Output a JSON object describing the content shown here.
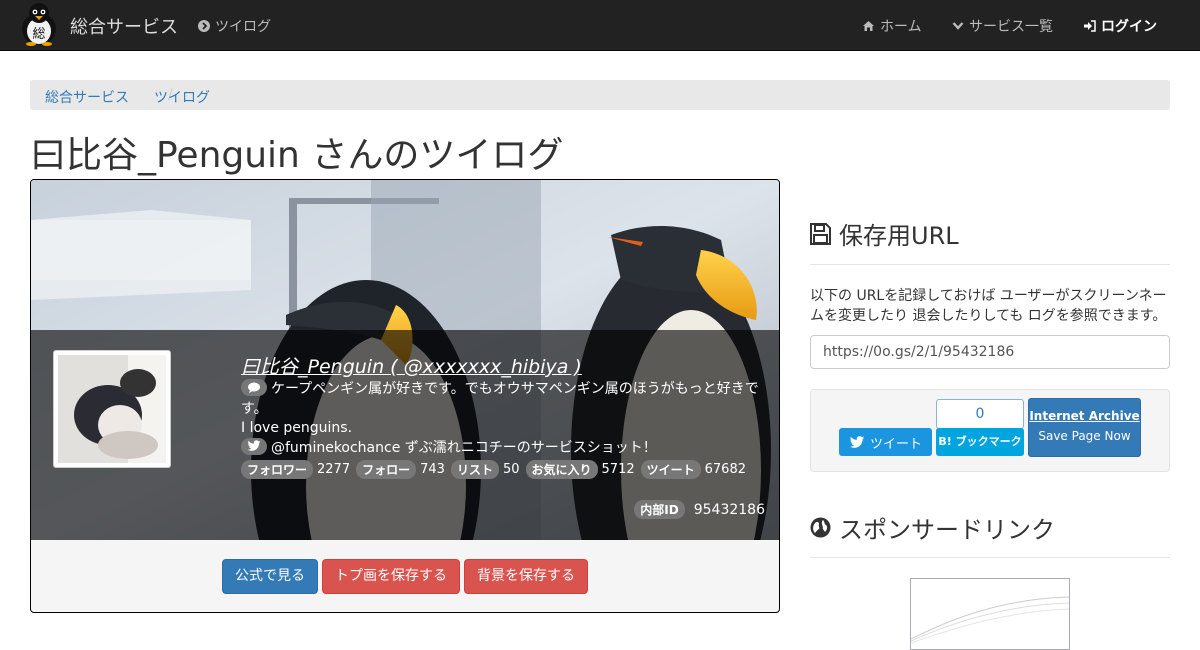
{
  "navbar": {
    "brand": "総合サービス",
    "logo_char": "総",
    "section": "ツイログ",
    "home": "ホーム",
    "services": "サービス一覧",
    "login": "ログイン"
  },
  "breadcrumb": [
    "総合サービス",
    "ツイログ"
  ],
  "page_title": "曰比谷_Penguin さんのツイログ",
  "profile": {
    "name_line": "曰比谷_Penguin ( @xxxxxxx_hibiya )",
    "bio_line1": "ケープペンギン属が好きです。でもオウサマペンギン属のほうがもっと好きで",
    "bio_line2": "す。",
    "bio_line3": "I love penguins.",
    "location": "@fuminekochance ずぶ濡れニコチーのサービスショット！",
    "stats": [
      {
        "label": "フォロワー",
        "value": "2277"
      },
      {
        "label": "フォロー",
        "value": "743"
      },
      {
        "label": "リスト",
        "value": "50"
      },
      {
        "label": "お気に入り",
        "value": "5712"
      },
      {
        "label": "ツイート",
        "value": "67682"
      }
    ],
    "internal_id_label": "内部ID",
    "internal_id": "95432186"
  },
  "buttons": {
    "official": "公式で見る",
    "save_icon": "トプ画を保存する",
    "save_bg": "背景を保存する"
  },
  "sidebar": {
    "save_heading": "保存用URL",
    "description": "以下の URLを記録しておけば ユーザーがスクリーンネームを変更したり 退会したりしても ログを参照できます。",
    "url": "https://0o.gs/2/1/95432186",
    "tweet": "ツイート",
    "hatena_count": "0",
    "hatena": "B! ブックマーク",
    "ia_title": "Internet Archive",
    "ia_sub": "Save Page Now",
    "sponsor_heading": "スポンサードリンク"
  },
  "colors": {
    "navbar": "#222222",
    "primary": "#337ab7",
    "danger": "#d9534f",
    "twitter": "#1b95e0",
    "hatena": "#00a4de"
  }
}
